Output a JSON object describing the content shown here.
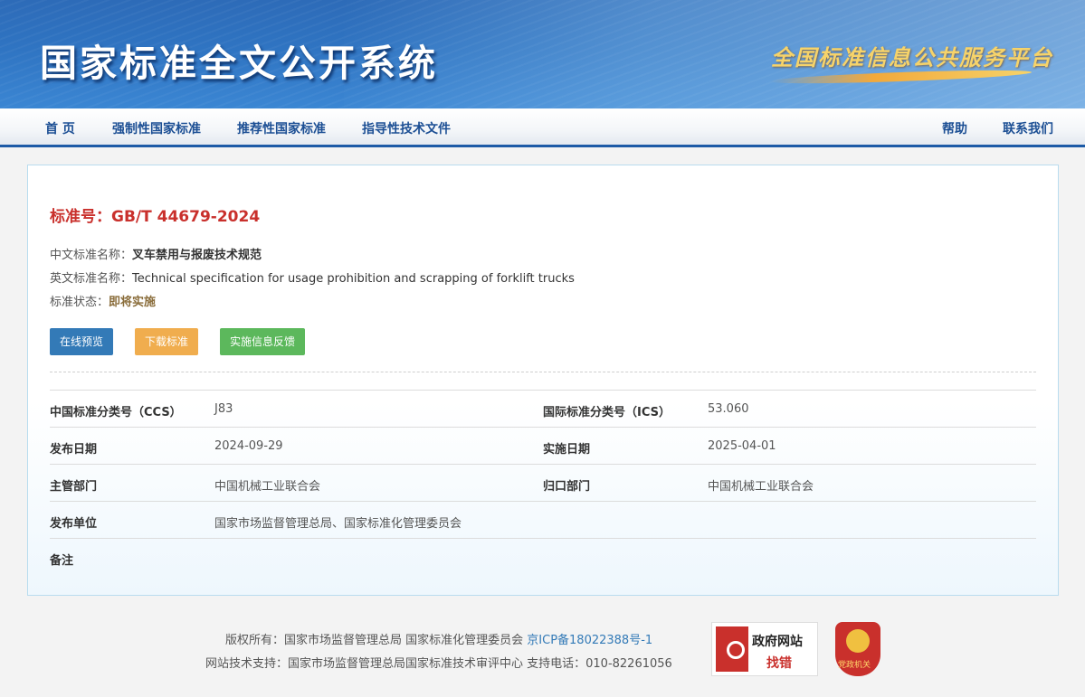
{
  "header": {
    "site_title": "国家标准全文公开系统",
    "platform_title": "全国标准信息公共服务平台"
  },
  "nav": {
    "home": "首 页",
    "mandatory": "强制性国家标准",
    "recommended": "推荐性国家标准",
    "guidance": "指导性技术文件",
    "help": "帮助",
    "contact": "联系我们"
  },
  "standard": {
    "number_label": "标准号：",
    "number": "GB/T 44679-2024",
    "cn_name_label": "中文标准名称：",
    "cn_name": "叉车禁用与报废技术规范",
    "en_name_label": "英文标准名称：",
    "en_name": "Technical specification for usage prohibition and scrapping of forklift trucks",
    "status_label": "标准状态：",
    "status": "即将实施"
  },
  "actions": {
    "preview": "在线预览",
    "download": "下载标准",
    "feedback": "实施信息反馈"
  },
  "details": {
    "ccs_label": "中国标准分类号（CCS）",
    "ccs": "J83",
    "ics_label": "国际标准分类号（ICS）",
    "ics": "53.060",
    "publish_date_label": "发布日期",
    "publish_date": "2024-09-29",
    "impl_date_label": "实施日期",
    "impl_date": "2025-04-01",
    "competent_label": "主管部门",
    "competent": "中国机械工业联合会",
    "centralized_label": "归口部门",
    "centralized": "中国机械工业联合会",
    "issuer_label": "发布单位",
    "issuer": "国家市场监督管理总局、国家标准化管理委员会",
    "remarks_label": "备注",
    "remarks": ""
  },
  "footer": {
    "copyright": "版权所有：国家市场监督管理总局 国家标准化管理委员会",
    "icp": "京ICP备18022388号-1",
    "support": "网站技术支持：国家市场监督管理总局国家标准技术审评中心 支持电话：010-82261056",
    "gov_badge_line1": "政府网站",
    "gov_badge_line2": "找错",
    "party_badge": "党政机关"
  },
  "colors": {
    "brand_blue": "#2f74c2",
    "accent_red": "#c9302c",
    "btn_blue": "#337ab7",
    "btn_orange": "#f0ad4e",
    "btn_green": "#5cb85c"
  }
}
